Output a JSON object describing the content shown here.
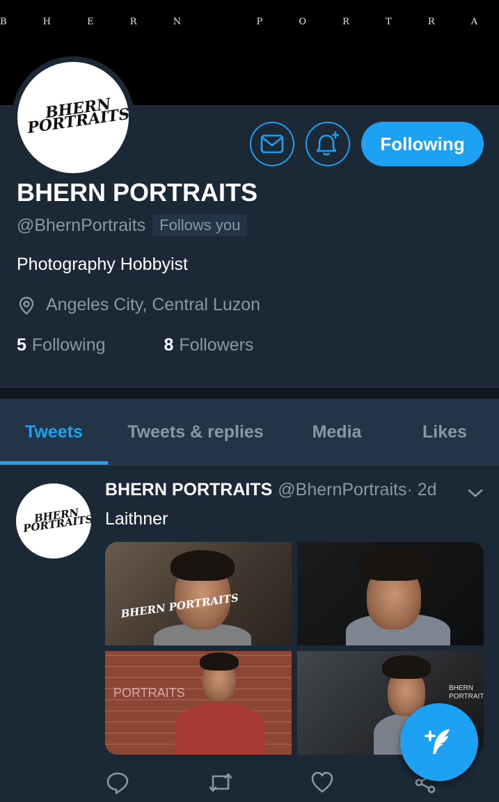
{
  "banner": {
    "text": "B H E R N   P O R T R A I T S"
  },
  "profile": {
    "logo_line1": "BHERN",
    "logo_line2": "PORTRAITS",
    "name": "BHERN PORTRAITS",
    "handle": "@BhernPortraits",
    "follows_you": "Follows you",
    "bio": "Photography Hobbyist",
    "location": "Angeles City, Central Luzon",
    "following_count": "5",
    "following_label": "Following",
    "followers_count": "8",
    "followers_label": "Followers"
  },
  "actions": {
    "follow_button": "Following",
    "message_icon": "envelope-icon",
    "notify_icon": "bell-plus-icon"
  },
  "tabs": [
    {
      "label": "Tweets",
      "active": true
    },
    {
      "label": "Tweets & replies",
      "active": false
    },
    {
      "label": "Media",
      "active": false
    },
    {
      "label": "Likes",
      "active": false
    }
  ],
  "tweet": {
    "name": "BHERN PORTRAITS",
    "handle": "@BhernPortraits",
    "time": " · 2d",
    "text": "Laithner",
    "photo_watermarks": [
      "BHERN PORTRAITS",
      "PORTRAITS",
      "BHERN\nPORTRAITS"
    ],
    "actions": [
      "reply-icon",
      "retweet-icon",
      "like-icon",
      "share-icon"
    ]
  },
  "fab": {
    "icon": "compose-tweet-icon"
  },
  "colors": {
    "background": "#1b2836",
    "accent": "#1da1f2",
    "secondary_text": "#8899a6",
    "tab_bar": "#243447"
  }
}
